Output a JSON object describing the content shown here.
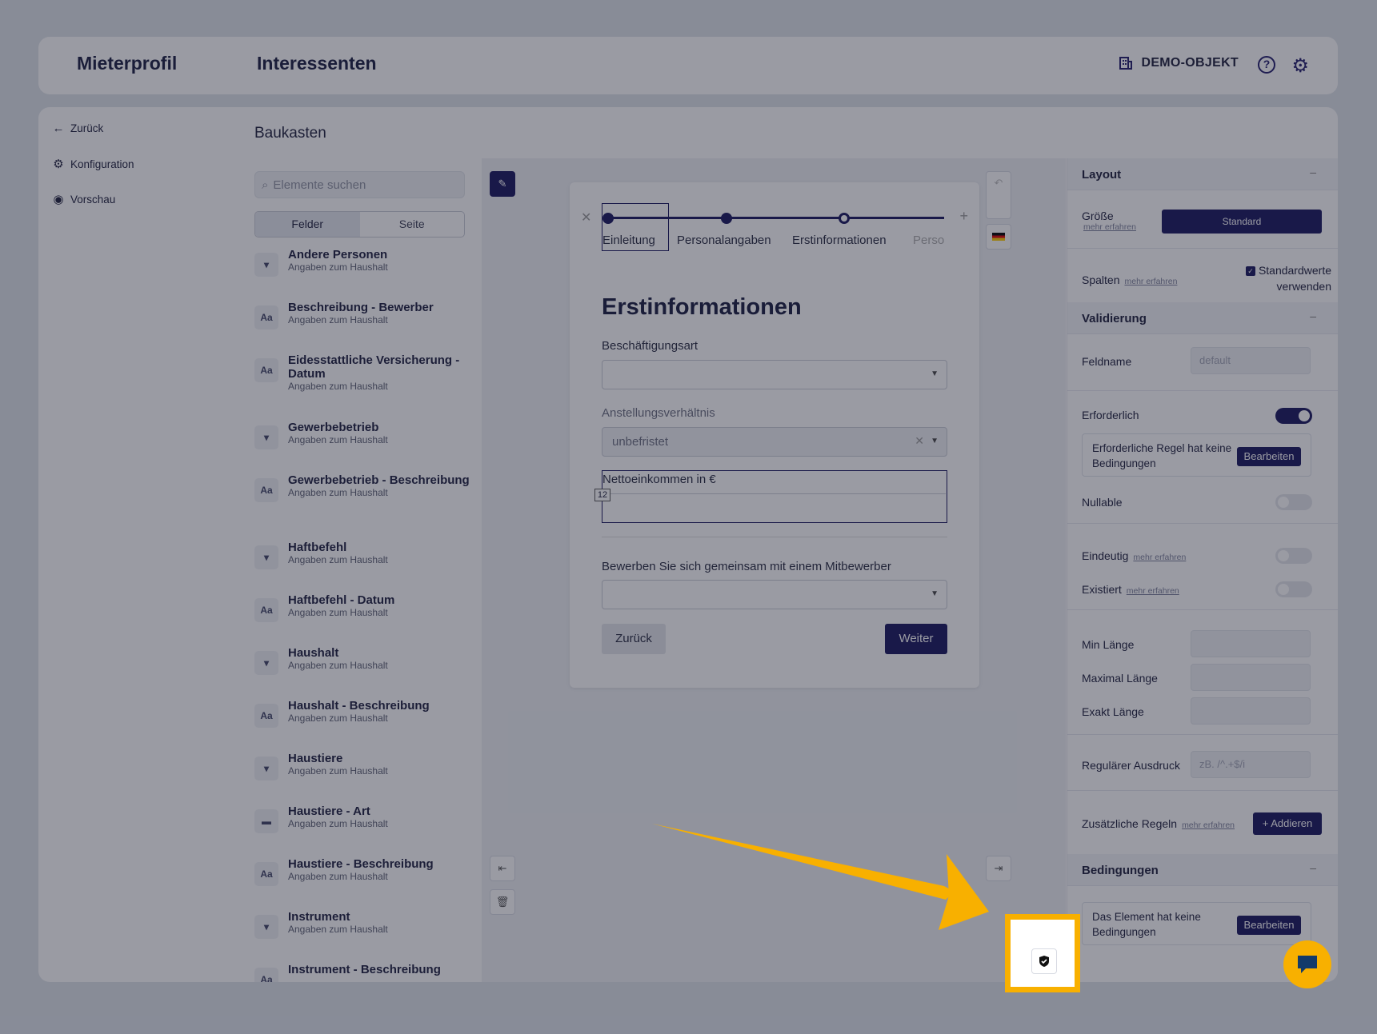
{
  "header": {
    "app_title": "Mieterprofil",
    "section_title": "Interessenten",
    "object_label": "DEMO-OBJEKT",
    "help_icon": "help-circle-icon",
    "settings_icon": "gear-icon"
  },
  "leftnav": {
    "back": "Zurück",
    "config": "Konfiguration",
    "preview": "Vorschau"
  },
  "baukasten": {
    "title": "Baukasten",
    "search_placeholder": "Elemente suchen",
    "tabs": [
      "Felder",
      "Seite"
    ],
    "items": [
      {
        "icon": "dropdown-icon",
        "name": "Andere Personen",
        "sub": "Angaben zum Haushalt"
      },
      {
        "icon": "text-icon",
        "name": "Beschreibung - Bewerber",
        "sub": "Angaben zum Haushalt"
      },
      {
        "icon": "text-icon",
        "name": "Eidesstattliche Versicherung - Datum",
        "sub": "Angaben zum Haushalt"
      },
      {
        "icon": "dropdown-icon",
        "name": "Gewerbebetrieb",
        "sub": "Angaben zum Haushalt"
      },
      {
        "icon": "text-icon",
        "name": "Gewerbebetrieb - Beschreibung",
        "sub": "Angaben zum Haushalt"
      },
      {
        "icon": "dropdown-icon",
        "name": "Haftbefehl",
        "sub": "Angaben zum Haushalt"
      },
      {
        "icon": "text-icon",
        "name": "Haftbefehl - Datum",
        "sub": "Angaben zum Haushalt"
      },
      {
        "icon": "dropdown-icon",
        "name": "Haushalt",
        "sub": "Angaben zum Haushalt"
      },
      {
        "icon": "text-icon",
        "name": "Haushalt - Beschreibung",
        "sub": "Angaben zum Haushalt"
      },
      {
        "icon": "dropdown-icon",
        "name": "Haustiere",
        "sub": "Angaben zum Haushalt"
      },
      {
        "icon": "tag-icon",
        "name": "Haustiere - Art",
        "sub": "Angaben zum Haushalt"
      },
      {
        "icon": "text-icon",
        "name": "Haustiere - Beschreibung",
        "sub": "Angaben zum Haushalt"
      },
      {
        "icon": "dropdown-icon",
        "name": "Instrument",
        "sub": "Angaben zum Haushalt"
      },
      {
        "icon": "text-icon",
        "name": "Instrument - Beschreibung",
        "sub": ""
      }
    ]
  },
  "form": {
    "steps": [
      "Einleitung",
      "Personalangaben",
      "Erstinformationen",
      "Perso"
    ],
    "heading": "Erstinformationen",
    "field1_label": "Beschäftigungsart",
    "field2_label": "Anstellungsverhältnis",
    "field2_value": "unbefristet",
    "field3_label": "Nettoeinkommen in €",
    "col_badge": "12",
    "field4_label": "Bewerben Sie sich gemeinsam mit einem Mitbewerber",
    "back_btn": "Zurück",
    "next_btn": "Weiter"
  },
  "props": {
    "layout": "Layout",
    "size_label": "Größe",
    "more": "mehr erfahren",
    "size_value": "Standard",
    "columns_label": "Spalten",
    "defaults_label": "Standardwerte verwenden",
    "validation": "Validierung",
    "fieldname_label": "Feldname",
    "fieldname_placeholder": "default",
    "required_label": "Erforderlich",
    "required_rule_text": "Erforderliche Regel hat keine Bedingungen",
    "edit_btn": "Bearbeiten",
    "nullable_label": "Nullable",
    "unique_label": "Eindeutig",
    "exists_label": "Existiert",
    "min_label": "Min Länge",
    "max_label": "Maximal Länge",
    "exact_label": "Exakt Länge",
    "regex_label": "Regulärer Ausdruck",
    "regex_placeholder": "zB. /^.+$/i",
    "extra_rules_label": "Zusätzliche Regeln",
    "add_btn": "+ Addieren",
    "conditions": "Bedingungen",
    "conditions_text": "Das Element hat keine Bedingungen",
    "collapse": "–"
  },
  "colors": {
    "accent": "#15135c",
    "highlight": "#f8b000"
  }
}
